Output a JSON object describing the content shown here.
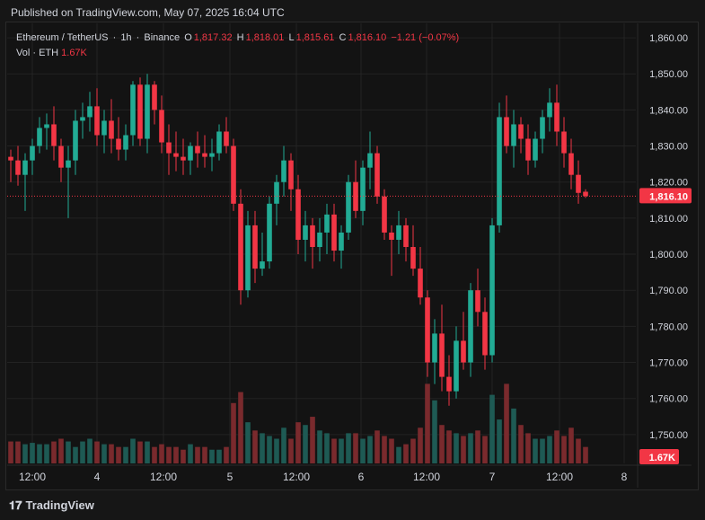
{
  "header": {
    "published": "Published on TradingView.com, May 07, 2025 16:04 UTC"
  },
  "legend": {
    "symbol": "Ethereum / TetherUS",
    "interval": "1h",
    "exchange": "Binance",
    "open_label": "O",
    "open": "1,817.32",
    "high_label": "H",
    "high": "1,818.01",
    "low_label": "L",
    "low": "1,815.61",
    "close_label": "C",
    "close": "1,816.10",
    "change": "−1.21 (−0.07%)",
    "volume_label": "Vol · ETH",
    "volume": "1.67K"
  },
  "brand": {
    "name": "TradingView",
    "icon": "tradingview-logo-icon"
  },
  "colors": {
    "up": "#22ab94",
    "down": "#f23645",
    "vol_up": "#1e5a54",
    "vol_down": "#7a2a2d",
    "grid": "#232323",
    "text": "#d1d4dc"
  },
  "chart_data": {
    "type": "candlestick",
    "instrument": "Ethereum / TetherUS",
    "interval": "1h",
    "ylim": [
      1742,
      1864
    ],
    "y_ticks": [
      "1,750.00",
      "1,760.00",
      "1,770.00",
      "1,780.00",
      "1,790.00",
      "1,800.00",
      "1,810.00",
      "1,820.00",
      "1,830.00",
      "1,840.00",
      "1,850.00",
      "1,860.00"
    ],
    "x_ticks": [
      "12:00",
      "4",
      "12:00",
      "5",
      "12:00",
      "6",
      "12:00",
      "7",
      "12:00",
      "8"
    ],
    "last_price_label": "1,816.10",
    "last_volume_label": "1.67K",
    "ohlc": [
      [
        1827,
        1829,
        1820,
        1826
      ],
      [
        1826,
        1830,
        1819,
        1822
      ],
      [
        1822,
        1828,
        1812,
        1826
      ],
      [
        1826,
        1832,
        1822,
        1830
      ],
      [
        1830,
        1838,
        1828,
        1835
      ],
      [
        1835,
        1839,
        1829,
        1836
      ],
      [
        1836,
        1841,
        1826,
        1830
      ],
      [
        1830,
        1832,
        1820,
        1824
      ],
      [
        1824,
        1830,
        1810,
        1826
      ],
      [
        1826,
        1840,
        1822,
        1837
      ],
      [
        1837,
        1842,
        1832,
        1838
      ],
      [
        1838,
        1845,
        1834,
        1841
      ],
      [
        1841,
        1846,
        1830,
        1833
      ],
      [
        1833,
        1840,
        1828,
        1837
      ],
      [
        1837,
        1843,
        1828,
        1832
      ],
      [
        1832,
        1838,
        1826,
        1829
      ],
      [
        1829,
        1836,
        1826,
        1833
      ],
      [
        1833,
        1848,
        1830,
        1847
      ],
      [
        1847,
        1849,
        1830,
        1832
      ],
      [
        1832,
        1850,
        1828,
        1847
      ],
      [
        1847,
        1848,
        1836,
        1840
      ],
      [
        1840,
        1844,
        1828,
        1831
      ],
      [
        1831,
        1836,
        1822,
        1828
      ],
      [
        1828,
        1834,
        1823,
        1827
      ],
      [
        1827,
        1832,
        1822,
        1826
      ],
      [
        1826,
        1831,
        1822,
        1830
      ],
      [
        1830,
        1834,
        1824,
        1828
      ],
      [
        1828,
        1833,
        1824,
        1827
      ],
      [
        1827,
        1832,
        1823,
        1828
      ],
      [
        1828,
        1836,
        1826,
        1834
      ],
      [
        1834,
        1838,
        1828,
        1830
      ],
      [
        1830,
        1832,
        1812,
        1814
      ],
      [
        1814,
        1818,
        1786,
        1790
      ],
      [
        1790,
        1812,
        1788,
        1808
      ],
      [
        1808,
        1812,
        1792,
        1796
      ],
      [
        1796,
        1806,
        1794,
        1798
      ],
      [
        1798,
        1816,
        1796,
        1814
      ],
      [
        1814,
        1822,
        1808,
        1820
      ],
      [
        1820,
        1830,
        1816,
        1826
      ],
      [
        1826,
        1828,
        1812,
        1818
      ],
      [
        1818,
        1822,
        1800,
        1804
      ],
      [
        1804,
        1812,
        1798,
        1808
      ],
      [
        1808,
        1810,
        1796,
        1802
      ],
      [
        1802,
        1810,
        1798,
        1806
      ],
      [
        1806,
        1814,
        1800,
        1811
      ],
      [
        1811,
        1814,
        1798,
        1801
      ],
      [
        1801,
        1808,
        1796,
        1806
      ],
      [
        1806,
        1822,
        1804,
        1820
      ],
      [
        1820,
        1826,
        1810,
        1812
      ],
      [
        1812,
        1826,
        1808,
        1824
      ],
      [
        1824,
        1834,
        1818,
        1828
      ],
      [
        1828,
        1830,
        1814,
        1816
      ],
      [
        1816,
        1818,
        1804,
        1806
      ],
      [
        1806,
        1808,
        1794,
        1804
      ],
      [
        1804,
        1812,
        1800,
        1808
      ],
      [
        1808,
        1810,
        1798,
        1802
      ],
      [
        1802,
        1808,
        1794,
        1796
      ],
      [
        1796,
        1802,
        1786,
        1788
      ],
      [
        1788,
        1790,
        1766,
        1770
      ],
      [
        1770,
        1782,
        1764,
        1778
      ],
      [
        1778,
        1786,
        1762,
        1766
      ],
      [
        1766,
        1772,
        1758,
        1762
      ],
      [
        1762,
        1780,
        1760,
        1776
      ],
      [
        1776,
        1784,
        1768,
        1770
      ],
      [
        1770,
        1792,
        1766,
        1790
      ],
      [
        1790,
        1796,
        1780,
        1784
      ],
      [
        1784,
        1788,
        1768,
        1772
      ],
      [
        1772,
        1810,
        1770,
        1808
      ],
      [
        1808,
        1842,
        1806,
        1838
      ],
      [
        1838,
        1844,
        1828,
        1830
      ],
      [
        1830,
        1840,
        1824,
        1836
      ],
      [
        1836,
        1838,
        1828,
        1832
      ],
      [
        1832,
        1836,
        1822,
        1826
      ],
      [
        1826,
        1834,
        1824,
        1832
      ],
      [
        1832,
        1840,
        1828,
        1838
      ],
      [
        1838,
        1846,
        1834,
        1842
      ],
      [
        1842,
        1847,
        1830,
        1834
      ],
      [
        1834,
        1838,
        1824,
        1828
      ],
      [
        1828,
        1832,
        1818,
        1822
      ],
      [
        1822,
        1826,
        1814,
        1817
      ],
      [
        1817.32,
        1818.01,
        1815.61,
        1816.1
      ]
    ],
    "volume": [
      0.8,
      0.8,
      0.7,
      0.75,
      0.7,
      0.7,
      0.8,
      0.9,
      0.8,
      0.6,
      0.8,
      0.9,
      0.8,
      0.7,
      0.7,
      0.6,
      0.6,
      0.9,
      0.8,
      0.8,
      0.6,
      0.7,
      0.6,
      0.6,
      0.5,
      0.7,
      0.6,
      0.6,
      0.5,
      0.5,
      0.6,
      2.2,
      2.6,
      1.5,
      1.2,
      1.1,
      1.0,
      0.9,
      1.3,
      0.9,
      1.5,
      1.4,
      1.7,
      1.2,
      1.1,
      0.9,
      0.9,
      1.1,
      1.1,
      0.9,
      1.0,
      1.2,
      1.0,
      0.9,
      0.6,
      0.7,
      0.9,
      1.3,
      2.9,
      2.3,
      1.4,
      1.2,
      1.1,
      1.0,
      1.1,
      1.2,
      1.0,
      2.5,
      1.6,
      2.9,
      2.0,
      1.4,
      1.1,
      0.9,
      0.9,
      1.0,
      1.2,
      1.0,
      1.3,
      0.9,
      0.6
    ]
  }
}
